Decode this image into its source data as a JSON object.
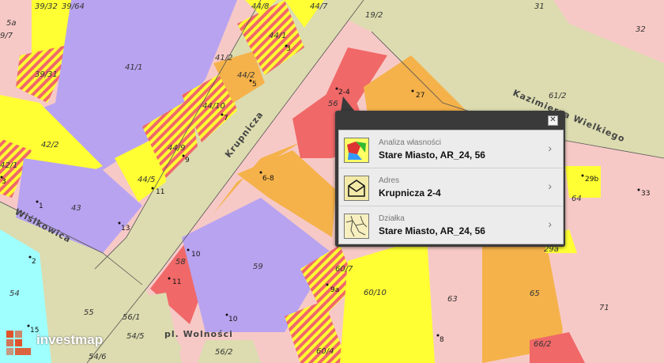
{
  "map": {
    "parcels": [
      "39/32",
      "39/64",
      "5a",
      "9/7",
      "44/8",
      "44/7",
      "19/2",
      "31",
      "32",
      "44/1",
      "41/2",
      "44/2",
      "41/1",
      "39/31",
      "44/10",
      "42/2",
      "44/9",
      "42/1",
      "44/5",
      "43",
      "58",
      "59",
      "60/7",
      "60/10",
      "63",
      "65",
      "71",
      "64",
      "54",
      "55",
      "56/1",
      "54/5",
      "54/6",
      "56/2",
      "60/4",
      "66/2",
      "29a",
      "61/2",
      "56"
    ],
    "numbers": [
      "3",
      "5",
      "7",
      "9",
      "11",
      "13",
      "6-8",
      "1",
      "2",
      "10",
      "11",
      "9a",
      "10",
      "15",
      "27",
      "2-4",
      "29b",
      "33",
      "8",
      "3"
    ],
    "streets": [
      "Krupnicza",
      "Wiślkowica",
      "Kazimierza Wielkiego",
      "pl. Wolności"
    ]
  },
  "popup": {
    "close": "✕",
    "items": [
      {
        "label": "Analiza własności",
        "value": "Stare Miasto, AR_24, 56",
        "icon": "ownership-map-icon"
      },
      {
        "label": "Adres",
        "value": "Krupnicza 2-4",
        "icon": "envelope-icon"
      },
      {
        "label": "Działka",
        "value": "Stare Miasto, AR_24, 56",
        "icon": "parcel-map-icon"
      }
    ],
    "chevron": "›"
  },
  "logo": {
    "text": "investmap",
    "color": "#e0532a"
  },
  "colors": {
    "purple": "#b8a3f0",
    "yellow": "#ffff33",
    "orange": "#f5b24a",
    "red": "#f06868",
    "pink": "#f7c9c6",
    "road": "#dcdcb0",
    "cyan": "#9fffff"
  }
}
